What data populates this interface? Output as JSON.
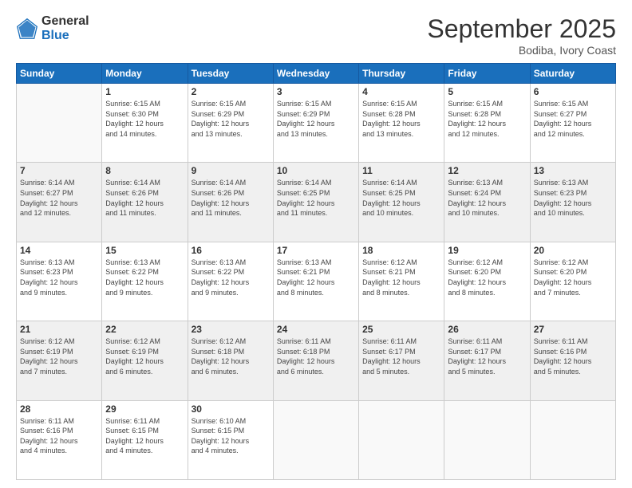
{
  "logo": {
    "general": "General",
    "blue": "Blue"
  },
  "header": {
    "month": "September 2025",
    "location": "Bodiba, Ivory Coast"
  },
  "weekdays": [
    "Sunday",
    "Monday",
    "Tuesday",
    "Wednesday",
    "Thursday",
    "Friday",
    "Saturday"
  ],
  "weeks": [
    [
      {
        "day": "",
        "info": ""
      },
      {
        "day": "1",
        "info": "Sunrise: 6:15 AM\nSunset: 6:30 PM\nDaylight: 12 hours\nand 14 minutes."
      },
      {
        "day": "2",
        "info": "Sunrise: 6:15 AM\nSunset: 6:29 PM\nDaylight: 12 hours\nand 13 minutes."
      },
      {
        "day": "3",
        "info": "Sunrise: 6:15 AM\nSunset: 6:29 PM\nDaylight: 12 hours\nand 13 minutes."
      },
      {
        "day": "4",
        "info": "Sunrise: 6:15 AM\nSunset: 6:28 PM\nDaylight: 12 hours\nand 13 minutes."
      },
      {
        "day": "5",
        "info": "Sunrise: 6:15 AM\nSunset: 6:28 PM\nDaylight: 12 hours\nand 12 minutes."
      },
      {
        "day": "6",
        "info": "Sunrise: 6:15 AM\nSunset: 6:27 PM\nDaylight: 12 hours\nand 12 minutes."
      }
    ],
    [
      {
        "day": "7",
        "info": "Sunrise: 6:14 AM\nSunset: 6:27 PM\nDaylight: 12 hours\nand 12 minutes."
      },
      {
        "day": "8",
        "info": "Sunrise: 6:14 AM\nSunset: 6:26 PM\nDaylight: 12 hours\nand 11 minutes."
      },
      {
        "day": "9",
        "info": "Sunrise: 6:14 AM\nSunset: 6:26 PM\nDaylight: 12 hours\nand 11 minutes."
      },
      {
        "day": "10",
        "info": "Sunrise: 6:14 AM\nSunset: 6:25 PM\nDaylight: 12 hours\nand 11 minutes."
      },
      {
        "day": "11",
        "info": "Sunrise: 6:14 AM\nSunset: 6:25 PM\nDaylight: 12 hours\nand 10 minutes."
      },
      {
        "day": "12",
        "info": "Sunrise: 6:13 AM\nSunset: 6:24 PM\nDaylight: 12 hours\nand 10 minutes."
      },
      {
        "day": "13",
        "info": "Sunrise: 6:13 AM\nSunset: 6:23 PM\nDaylight: 12 hours\nand 10 minutes."
      }
    ],
    [
      {
        "day": "14",
        "info": "Sunrise: 6:13 AM\nSunset: 6:23 PM\nDaylight: 12 hours\nand 9 minutes."
      },
      {
        "day": "15",
        "info": "Sunrise: 6:13 AM\nSunset: 6:22 PM\nDaylight: 12 hours\nand 9 minutes."
      },
      {
        "day": "16",
        "info": "Sunrise: 6:13 AM\nSunset: 6:22 PM\nDaylight: 12 hours\nand 9 minutes."
      },
      {
        "day": "17",
        "info": "Sunrise: 6:13 AM\nSunset: 6:21 PM\nDaylight: 12 hours\nand 8 minutes."
      },
      {
        "day": "18",
        "info": "Sunrise: 6:12 AM\nSunset: 6:21 PM\nDaylight: 12 hours\nand 8 minutes."
      },
      {
        "day": "19",
        "info": "Sunrise: 6:12 AM\nSunset: 6:20 PM\nDaylight: 12 hours\nand 8 minutes."
      },
      {
        "day": "20",
        "info": "Sunrise: 6:12 AM\nSunset: 6:20 PM\nDaylight: 12 hours\nand 7 minutes."
      }
    ],
    [
      {
        "day": "21",
        "info": "Sunrise: 6:12 AM\nSunset: 6:19 PM\nDaylight: 12 hours\nand 7 minutes."
      },
      {
        "day": "22",
        "info": "Sunrise: 6:12 AM\nSunset: 6:19 PM\nDaylight: 12 hours\nand 6 minutes."
      },
      {
        "day": "23",
        "info": "Sunrise: 6:12 AM\nSunset: 6:18 PM\nDaylight: 12 hours\nand 6 minutes."
      },
      {
        "day": "24",
        "info": "Sunrise: 6:11 AM\nSunset: 6:18 PM\nDaylight: 12 hours\nand 6 minutes."
      },
      {
        "day": "25",
        "info": "Sunrise: 6:11 AM\nSunset: 6:17 PM\nDaylight: 12 hours\nand 5 minutes."
      },
      {
        "day": "26",
        "info": "Sunrise: 6:11 AM\nSunset: 6:17 PM\nDaylight: 12 hours\nand 5 minutes."
      },
      {
        "day": "27",
        "info": "Sunrise: 6:11 AM\nSunset: 6:16 PM\nDaylight: 12 hours\nand 5 minutes."
      }
    ],
    [
      {
        "day": "28",
        "info": "Sunrise: 6:11 AM\nSunset: 6:16 PM\nDaylight: 12 hours\nand 4 minutes."
      },
      {
        "day": "29",
        "info": "Sunrise: 6:11 AM\nSunset: 6:15 PM\nDaylight: 12 hours\nand 4 minutes."
      },
      {
        "day": "30",
        "info": "Sunrise: 6:10 AM\nSunset: 6:15 PM\nDaylight: 12 hours\nand 4 minutes."
      },
      {
        "day": "",
        "info": ""
      },
      {
        "day": "",
        "info": ""
      },
      {
        "day": "",
        "info": ""
      },
      {
        "day": "",
        "info": ""
      }
    ]
  ]
}
